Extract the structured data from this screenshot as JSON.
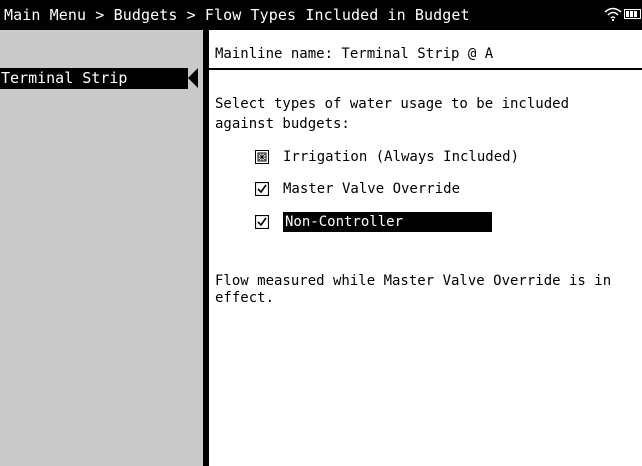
{
  "header": {
    "breadcrumb": "Main Menu > Budgets > Flow Types Included in Budget",
    "status_icons": [
      "wifi-icon",
      "battery-icon"
    ]
  },
  "sidebar": {
    "items": [
      {
        "label": "Terminal Strip",
        "selected": true
      }
    ]
  },
  "main": {
    "mainline_label": "Mainline name: Terminal Strip @ A",
    "prompt": "Select types of water usage to be included against budgets:",
    "options": [
      {
        "label": "Irrigation (Always Included)",
        "state": "indeterminate-locked"
      },
      {
        "label": "Master Valve Override",
        "state": "checked"
      },
      {
        "label": "Non-Controller",
        "state": "checked",
        "focused": true
      }
    ],
    "description": "Flow measured while Master Valve Override is in effect."
  },
  "colors": {
    "bar": "#000000",
    "sidebar": "#c9c9c9",
    "background": "#ffffff",
    "highlight_text": "#ffffff"
  }
}
